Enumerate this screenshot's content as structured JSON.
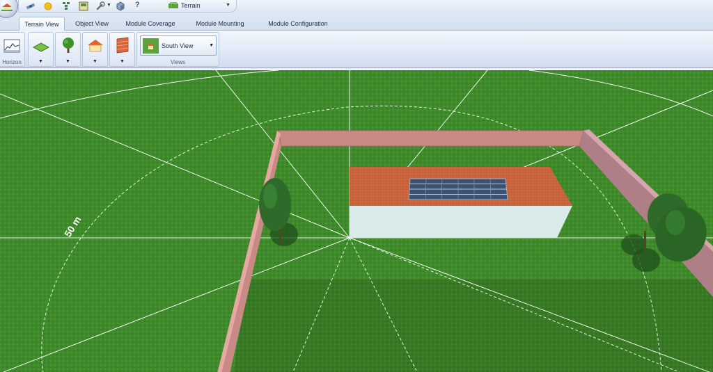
{
  "quick_access": {
    "icons": [
      "app-logo-icon",
      "satellite-icon",
      "sun-icon",
      "module-grid-icon",
      "panel-icon",
      "wrench-icon",
      "box-icon",
      "help-icon"
    ],
    "help_glyph": "?",
    "terrain_dropdown": {
      "selected": "Terrain"
    }
  },
  "tabs": [
    {
      "label": "Terrain View",
      "active": true
    },
    {
      "label": "Object View",
      "active": false
    },
    {
      "label": "Module Coverage",
      "active": false
    },
    {
      "label": "Module Mounting",
      "active": false
    },
    {
      "label": "Module Configuration",
      "active": false
    }
  ],
  "ribbon": {
    "horizon_group_label": "Horizon",
    "object_buttons": [
      "ground-plane-icon",
      "tree-icon",
      "house-icon",
      "brick-wall-icon"
    ],
    "views_group_label": "Views",
    "view_dropdown": {
      "selected": "South View"
    }
  },
  "viewport": {
    "distance_label": "50 m",
    "colors": {
      "grass": "#3f8a2a",
      "wall": "#c98a86",
      "roof": "#c8623a",
      "building_wall": "#d8ebe8",
      "solar_panel": "#3d5273",
      "tree": "#2e6b2a"
    }
  }
}
